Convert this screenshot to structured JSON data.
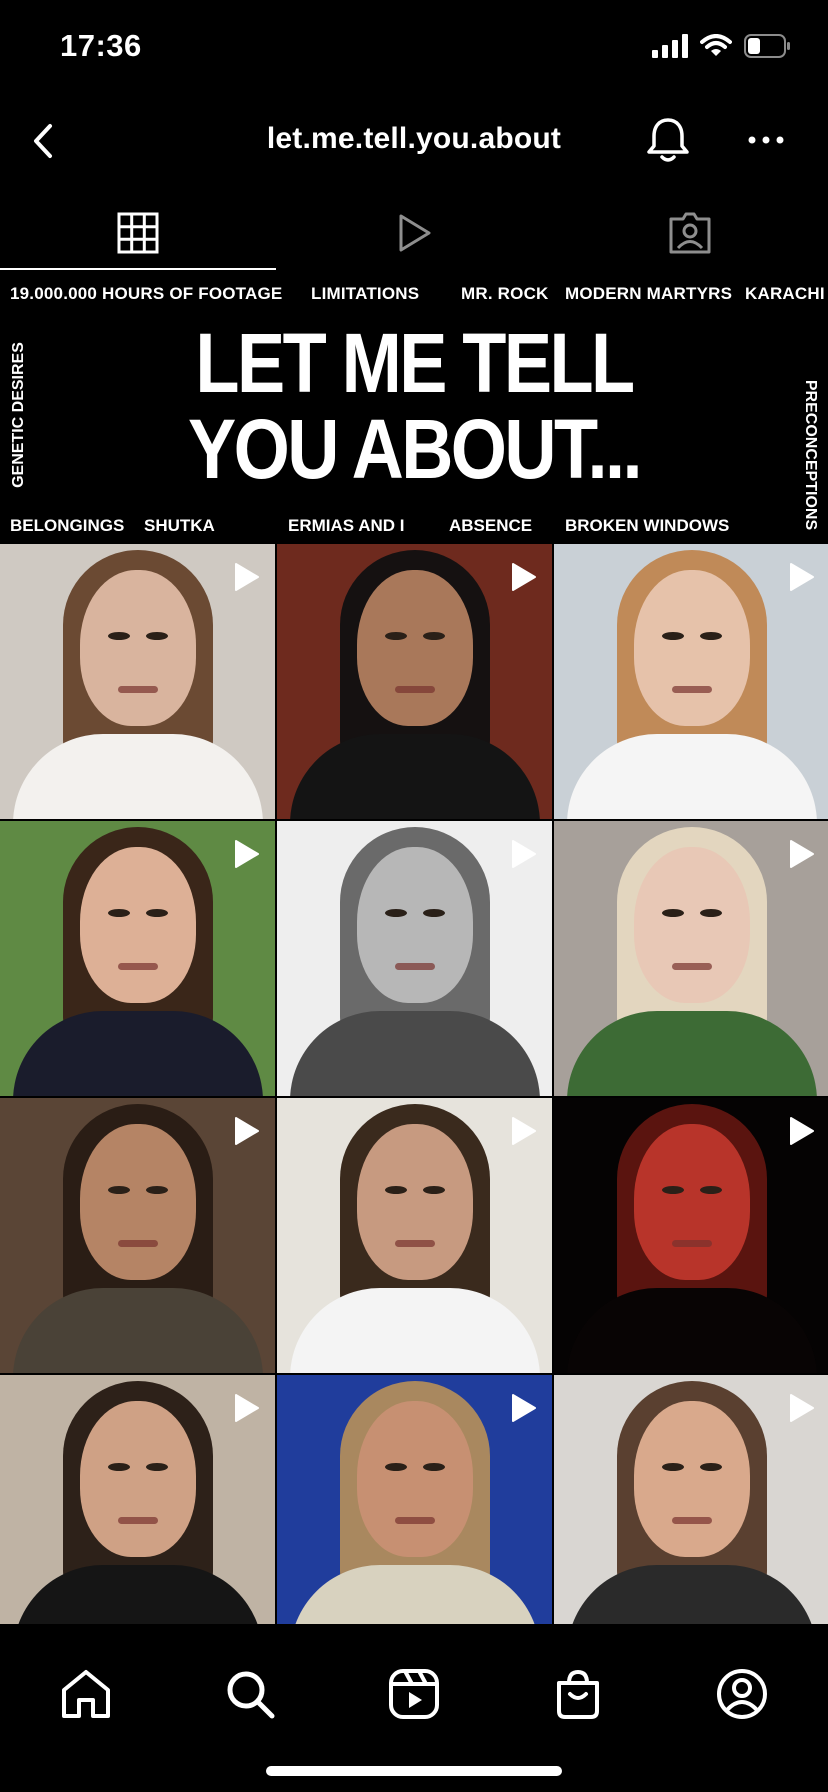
{
  "status": {
    "time": "17:36"
  },
  "nav": {
    "title": "let.me.tell.you.about"
  },
  "tabs": [
    "grid",
    "reels",
    "tagged"
  ],
  "highlights_top": [
    "19.000.000 HOURS OF FOOTAGE",
    "LIMITATIONS",
    "MR. ROCK",
    "MODERN MARTYRS",
    "KARACHI"
  ],
  "banner": {
    "line1": "LET ME TELL",
    "line2": "YOU ABOUT..."
  },
  "side_left": "GENETIC DESIRES",
  "side_right": "PRECONCEPTIONS",
  "highlights_bottom": [
    "BELONGINGS",
    "SHUTKA",
    "ERMIAS AND I",
    "ABSENCE",
    "BROKEN WINDOWS"
  ],
  "posts": [
    {
      "bg": "#cfc9c2",
      "skin": "#d9b49e",
      "hair": "#6b4a33",
      "shirt": "#f3f1ee"
    },
    {
      "bg": "#6e2a1e",
      "skin": "#a9785a",
      "hair": "#151111",
      "shirt": "#141414"
    },
    {
      "bg": "#c9d0d6",
      "skin": "#e6c2aa",
      "hair": "#c08a58",
      "shirt": "#f5f5f5"
    },
    {
      "bg": "#5f8a44",
      "skin": "#ddb096",
      "hair": "#3a2619",
      "shirt": "#1a1c2c"
    },
    {
      "bg": "#eeeeee",
      "skin": "#b7b7b7",
      "hair": "#6a6a6a",
      "shirt": "#4a4a4a"
    },
    {
      "bg": "#a7a09a",
      "skin": "#e8c8b6",
      "hair": "#e3d6bf",
      "shirt": "#3d6b35"
    },
    {
      "bg": "#5a4536",
      "skin": "#b58465",
      "hair": "#2a1d15",
      "shirt": "#4a4237"
    },
    {
      "bg": "#e6e3dc",
      "skin": "#c79a80",
      "hair": "#3a2a1d",
      "shirt": "#f4f4f4"
    },
    {
      "bg": "#050303",
      "skin": "#b8342a",
      "hair": "#5a140f",
      "shirt": "#080404"
    },
    {
      "bg": "#bfb3a4",
      "skin": "#cfa185",
      "hair": "#2d2119",
      "shirt": "#151515"
    },
    {
      "bg": "#203d9c",
      "skin": "#c79072",
      "hair": "#a9885f",
      "shirt": "#d8d2bf"
    },
    {
      "bg": "#d9d6d2",
      "skin": "#d9a98c",
      "hair": "#5a4030",
      "shirt": "#2a2a2a"
    }
  ],
  "play_icons": [
    true,
    true,
    true,
    true,
    true,
    true,
    true,
    true,
    true,
    true,
    true,
    true
  ],
  "bottom_tabs": [
    "home",
    "search",
    "reels",
    "shop",
    "profile"
  ]
}
